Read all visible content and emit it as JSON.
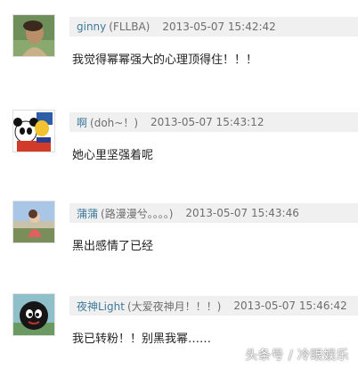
{
  "comments": [
    {
      "user": "ginny",
      "note": "(FLLBA)",
      "time": "2013-05-07 15:42:42",
      "text": "我觉得幂幂强大的心理顶得住！！！",
      "avatar_icon": "avatar-photo-green-icon"
    },
    {
      "user": "啊",
      "note": "(doh~！)",
      "time": "2013-05-07 15:43:12",
      "text": "她心里坚强着呢",
      "avatar_icon": "avatar-cartoon-panda-icon"
    },
    {
      "user": "蒲蒲",
      "note": "(路漫漫兮。。。。)",
      "time": "2013-05-07 15:43:46",
      "text": "黑出感情了已经",
      "avatar_icon": "avatar-photo-sky-icon"
    },
    {
      "user": "夜神Light",
      "note": "(大爱夜神月！！！)",
      "time": "2013-05-07 15:46:42",
      "text": "我已转粉！！别黑我幂……",
      "avatar_icon": "avatar-black-ball-icon"
    }
  ],
  "watermark": "头条号 / 冷眼娱乐",
  "colors": {
    "username": "#3d7a9b",
    "header_bg": "#f0f0f0",
    "meta": "#6e6e6e"
  }
}
